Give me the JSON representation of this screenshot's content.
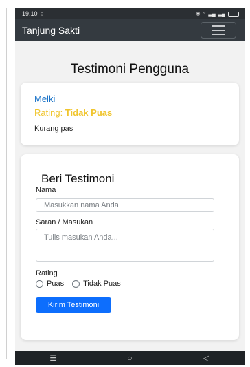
{
  "status_bar": {
    "time": "19.10",
    "status_icons": [
      "whatsapp-icon",
      "alarm-icon",
      "wifi-icon",
      "signal-icon",
      "signal-icon",
      "battery-icon"
    ]
  },
  "navbar": {
    "brand": "Tanjung Sakti",
    "menu_icon": "hamburger-icon"
  },
  "page": {
    "title": "Testimoni Pengguna"
  },
  "testimonials": [
    {
      "name": "Melki",
      "rating_prefix": "Rating: ",
      "rating_value": "Tidak Puas",
      "comment": "Kurang pas"
    }
  ],
  "form": {
    "title": "Beri Testimoni",
    "name_label": "Nama",
    "name_placeholder": "Masukkan nama Anda",
    "feedback_label": "Saran / Masukan",
    "feedback_placeholder": "Tulis masukan Anda...",
    "rating_label": "Rating",
    "rating_options": [
      "Puas",
      "Tidak Puas"
    ],
    "submit_label": "Kirim Testimoni"
  },
  "system_nav": {
    "icons": [
      "recent-apps-icon",
      "home-icon",
      "back-icon"
    ]
  },
  "colors": {
    "navbar": "#343a40",
    "reviewer_name": "#1a73c8",
    "rating": "#f0c52e",
    "primary_button": "#0d6efd"
  }
}
